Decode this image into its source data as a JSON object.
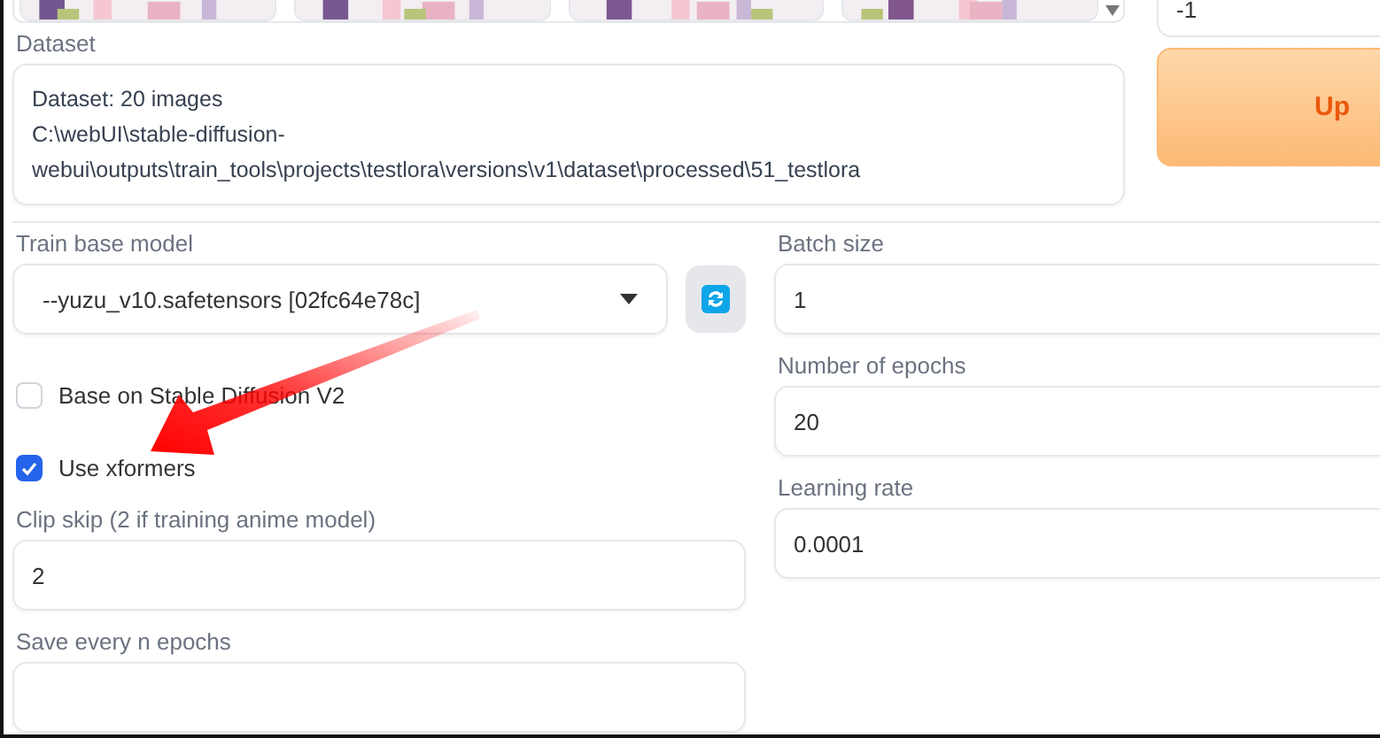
{
  "seed_field": {
    "value": "-1"
  },
  "update_button": {
    "label": "Up"
  },
  "dataset": {
    "label": "Dataset",
    "lines": [
      "Dataset: 20 images",
      "C:\\webUI\\stable-diffusion-",
      "webui\\outputs\\train_tools\\projects\\testlora\\versions\\v1\\dataset\\processed\\51_testlora"
    ]
  },
  "base_model": {
    "label": "Train base model",
    "value": "--yuzu_v10.safetensors [02fc64e78c]"
  },
  "checkboxes": [
    {
      "label": "Base on Stable Diffusion V2",
      "checked": false
    },
    {
      "label": "Use xformers",
      "checked": true
    }
  ],
  "left_fields": [
    {
      "label": "Clip skip (2 if training anime model)",
      "value": "2"
    },
    {
      "label": "Save every n epochs"
    }
  ],
  "right_fields": [
    {
      "label": "Batch size",
      "value": "1"
    },
    {
      "label": "Number of epochs",
      "value": "20"
    },
    {
      "label": "Learning rate",
      "value": "0.0001"
    }
  ]
}
